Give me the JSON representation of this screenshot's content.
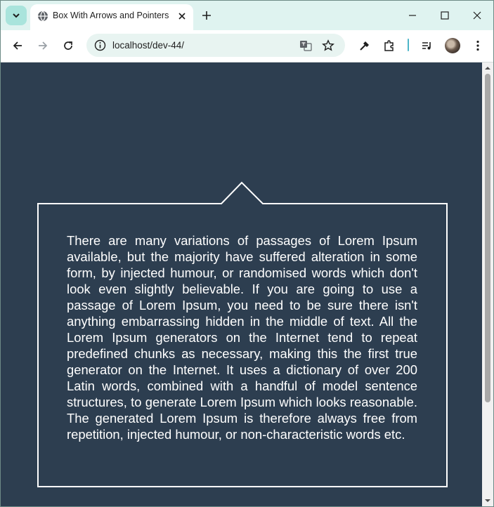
{
  "browser": {
    "tab": {
      "title": "Box With Arrows and Pointers"
    },
    "address_bar": {
      "url": "localhost/dev-44/"
    }
  },
  "page": {
    "paragraph": "There are many variations of passages of Lorem Ipsum available, but the majority have suffered alteration in some form, by injected humour, or randomised words which don't look even slightly believable. If you are going to use a passage of Lorem Ipsum, you need to be sure there isn't anything embarrassing hidden in the middle of text. All the Lorem Ipsum generators on the Internet tend to repeat predefined chunks as necessary, making this the first true generator on the Internet. It uses a dictionary of over 200 Latin words, combined with a handful of model sentence structures, to generate Lorem Ipsum which looks reasonable. The generated Lorem Ipsum is therefore always free from repetition, injected humour, or non-characteristic words etc."
  },
  "colors": {
    "page_background": "#2d3e50",
    "box_border": "#ffffff",
    "text": "#ffffff",
    "tabstrip": "#dff3f0"
  },
  "icons": [
    "tab-search-icon",
    "globe-icon",
    "close-icon",
    "plus-icon",
    "minimize-icon",
    "maximize-icon",
    "window-close-icon",
    "back-arrow-icon",
    "forward-arrow-icon",
    "reload-icon",
    "site-info-icon",
    "translate-icon",
    "star-icon",
    "eyedropper-icon",
    "extensions-icon",
    "media-controls-icon",
    "avatar",
    "kebab-menu-icon"
  ]
}
